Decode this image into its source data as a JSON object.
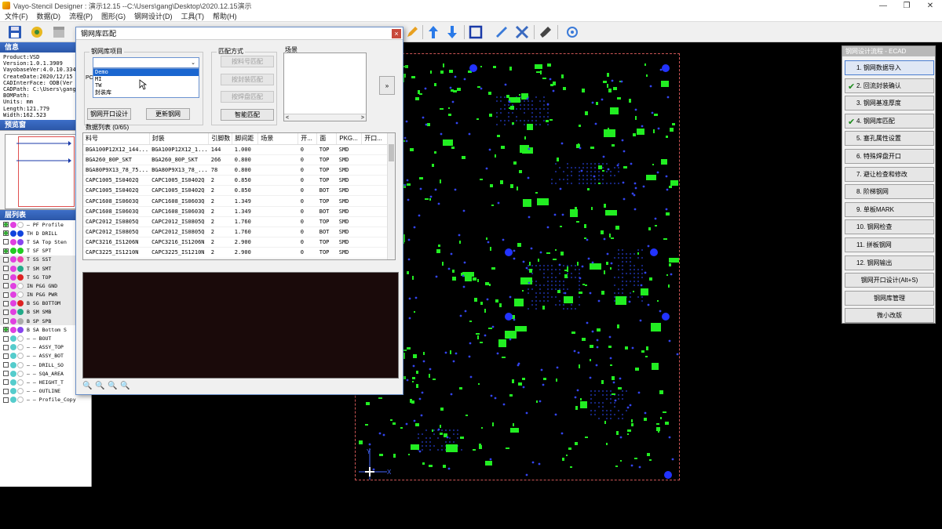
{
  "window": {
    "title": "Vayo-Stencil Designer : 演示12.15  --C:\\Users\\gang\\Desktop\\2020.12.15演示",
    "min_label": "—",
    "max_label": "❐",
    "close_label": "✕"
  },
  "menu": [
    "文件(F)",
    "数据(D)",
    "流程(P)",
    "图形(G)",
    "钢网设计(D)",
    "工具(T)",
    "帮助(H)"
  ],
  "left": {
    "info_title": "信息",
    "info_lines": [
      "Product:VSD",
      "Version:1.0.1.3909",
      "VayobaseVer:4.0.10.3342",
      "CreateDate:2020/12/15 13:",
      "CADInterFace: ODB(Ver 4.0",
      "CADPath: C:\\Users\\gang\\De",
      "BOMPath:",
      "Units: mm",
      "Length:121.779",
      "Width:162.523"
    ],
    "preview_title": "预览窗",
    "layers_title": "层列表",
    "layers": [
      {
        "on": true,
        "c1": "#e040e0",
        "c2": "#ffffff",
        "text": "— PF  Profile"
      },
      {
        "on": true,
        "c1": "#1144dd",
        "c2": "#1144dd",
        "text": "TH D  DRILL"
      },
      {
        "on": false,
        "c1": "#e040e0",
        "c2": "#8844ee",
        "text": "T  SA  Top Sten"
      },
      {
        "on": true,
        "c1": "#22cc22",
        "c2": "#22cc22",
        "text": "T  SF  SPT"
      },
      {
        "on": false,
        "c1": "#e040e0",
        "c2": "#ee44aa",
        "text": "T  SS  SST"
      },
      {
        "on": false,
        "c1": "#e040e0",
        "c2": "#22aa88",
        "text": "T  SM  SMT"
      },
      {
        "on": false,
        "c1": "#e040e0",
        "c2": "#dd2222",
        "text": "T  SG  TOP"
      },
      {
        "on": false,
        "c1": "#e040e0",
        "c2": "#ffffff",
        "text": "IN P&G GND"
      },
      {
        "on": false,
        "c1": "#e040e0",
        "c2": "#ffffff",
        "text": "IN P&G PWR"
      },
      {
        "on": false,
        "c1": "#e040e0",
        "c2": "#dd2222",
        "text": "B  SG  BOTTOM"
      },
      {
        "on": false,
        "c1": "#e040e0",
        "c2": "#22aa88",
        "text": "B  SM  SMB"
      },
      {
        "on": false,
        "c1": "#e040e0",
        "c2": "#aaaaaa",
        "text": "B  SP  SPB"
      },
      {
        "on": true,
        "c1": "#e040e0",
        "c2": "#8844ee",
        "text": "B  SA  Bottom S"
      },
      {
        "on": false,
        "c1": "#55cccc",
        "c2": "#ffffff",
        "text": "— —  BOUT"
      },
      {
        "on": false,
        "c1": "#55cccc",
        "c2": "#ffffff",
        "text": "— —  ASSY_TOP"
      },
      {
        "on": false,
        "c1": "#55cccc",
        "c2": "#ffffff",
        "text": "— —  ASSY_BOT"
      },
      {
        "on": false,
        "c1": "#55cccc",
        "c2": "#ffffff",
        "text": "— —  DRILL_SO"
      },
      {
        "on": false,
        "c1": "#55cccc",
        "c2": "#ffffff",
        "text": "— —  SQA_AREA"
      },
      {
        "on": false,
        "c1": "#55cccc",
        "c2": "#ffffff",
        "text": "— —  HEIGHT_T"
      },
      {
        "on": false,
        "c1": "#55cccc",
        "c2": "#ffffff",
        "text": "— —  OUTLINE"
      },
      {
        "on": false,
        "c1": "#55cccc",
        "c2": "#ffffff",
        "text": "— —  Profile_Copy"
      }
    ]
  },
  "dialog": {
    "title": "钢网库匹配",
    "close": "×",
    "lib_group_label": "钢网库项目",
    "combo_arrow": "⌄",
    "dropdown_items": [
      "Demo",
      "MI",
      "TW",
      "封装库"
    ],
    "pcb_label": "PC",
    "btn_stencil_design": "钢网开口设计",
    "btn_update": "更新钢网",
    "match_group_label": "匹配方式",
    "match_btns": [
      "按料号匹配",
      "按封装匹配",
      "按焊盘匹配"
    ],
    "btn_smart": "智能匹配",
    "scene_group_label": "场景",
    "scroll_left": "<",
    "scroll_right": ">",
    "btn_arrow": "»",
    "list_label": "数据列表 (0/65)",
    "columns": [
      "料号",
      "封装",
      "引脚数",
      "脚间距",
      "场景",
      "开...",
      "面",
      "PKG...",
      "开口..."
    ],
    "rows": [
      [
        "BGA100P12X12_144...",
        "BGA100P12X12_1...",
        "144",
        "1.000",
        "",
        "0",
        "TOP",
        "SMD",
        ""
      ],
      [
        "BGA260_80P_SKT",
        "BGA260_80P_SKT",
        "266",
        "0.800",
        "",
        "0",
        "TOP",
        "SMD",
        ""
      ],
      [
        "BGA80P9X13_78_75...",
        "BGA80P9X13_78_...",
        "78",
        "0.800",
        "",
        "0",
        "TOP",
        "SMD",
        ""
      ],
      [
        "CAPC1005_IS0402Q",
        "CAPC1005_IS0402Q",
        "2",
        "0.850",
        "",
        "0",
        "TOP",
        "SMD",
        ""
      ],
      [
        "CAPC1005_IS0402Q",
        "CAPC1005_IS0402Q",
        "2",
        "0.850",
        "",
        "0",
        "BOT",
        "SMD",
        ""
      ],
      [
        "CAPC1608_IS0603Q",
        "CAPC1608_IS0603Q",
        "2",
        "1.349",
        "",
        "0",
        "TOP",
        "SMD",
        ""
      ],
      [
        "CAPC1608_IS0603Q",
        "CAPC1608_IS0603Q",
        "2",
        "1.349",
        "",
        "0",
        "BOT",
        "SMD",
        ""
      ],
      [
        "CAPC2012_IS0805Q",
        "CAPC2012_IS0805Q",
        "2",
        "1.760",
        "",
        "0",
        "TOP",
        "SMD",
        ""
      ],
      [
        "CAPC2012_IS0805Q",
        "CAPC2012_IS0805Q",
        "2",
        "1.760",
        "",
        "0",
        "BOT",
        "SMD",
        ""
      ],
      [
        "CAPC3216_IS1206N",
        "CAPC3216_IS1206N",
        "2",
        "2.900",
        "",
        "0",
        "TOP",
        "SMD",
        ""
      ],
      [
        "CAPC3225_IS1210N",
        "CAPC3225_IS1210N",
        "2",
        "2.900",
        "",
        "0",
        "TOP",
        "SMD",
        ""
      ]
    ]
  },
  "right": {
    "title": "钢网设计流程 - ECAD",
    "steps": [
      {
        "label": "1. 钢网数据导入",
        "done": false,
        "active": true
      },
      {
        "label": "2. 回流封装确认",
        "done": true,
        "active": false
      },
      {
        "label": "3. 钢网基准厚度",
        "done": false,
        "active": false
      },
      {
        "label": "4. 钢网库匹配",
        "done": true,
        "active": false
      },
      {
        "label": "5. 塞孔属性设置",
        "done": false,
        "active": false
      },
      {
        "label": "6. 特殊焊盘开口",
        "done": false,
        "active": false
      },
      {
        "label": "7. 避让检查和修改",
        "done": false,
        "active": false
      },
      {
        "label": "8. 阶梯钢网",
        "done": false,
        "active": false
      },
      {
        "label": "9. 单板MARK",
        "done": false,
        "active": false
      },
      {
        "label": "10. 钢网检查",
        "done": false,
        "active": false
      },
      {
        "label": "11. 拼板钢网",
        "done": false,
        "active": false
      },
      {
        "label": "12. 钢网输出",
        "done": false,
        "active": false
      }
    ],
    "extra": [
      "钢网开口设计(Alt+S)",
      "钢网库管理",
      "微小改版"
    ]
  },
  "pcb": {
    "axis_x": "X",
    "axis_y": "Y",
    "colors": {
      "pad": "#22ee22",
      "via": "#3344ee",
      "fiducial": "#2233ff",
      "grid": "#1a2a8a"
    }
  }
}
